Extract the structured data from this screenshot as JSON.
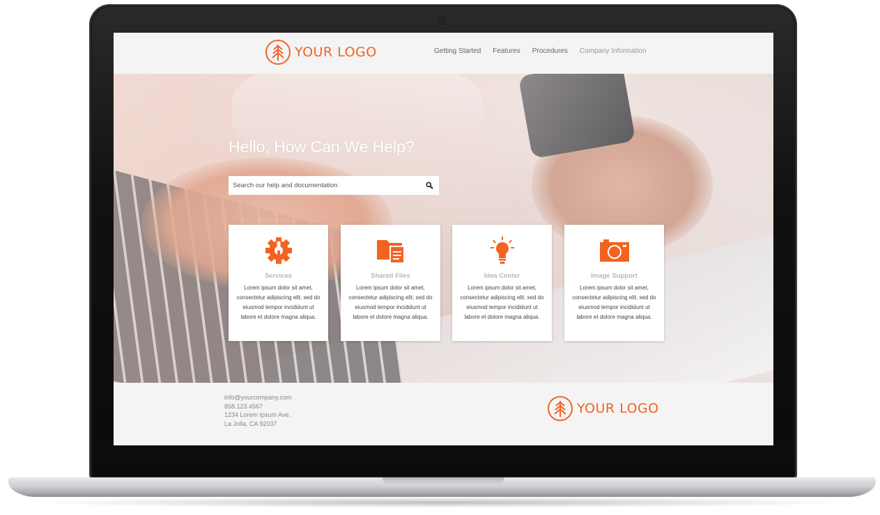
{
  "header": {
    "logo_text": "YOUR LOGO",
    "nav": [
      {
        "label": "Getting Started"
      },
      {
        "label": "Features"
      },
      {
        "label": "Procedures"
      },
      {
        "label": "Company Information"
      }
    ]
  },
  "hero": {
    "title": "Hello, How Can We Help?",
    "search_placeholder": "Search our help and documentation"
  },
  "cards": [
    {
      "icon": "gear-icon",
      "title": "Services",
      "body": "Lorem ipsum dolor sit amet, consectetur adipiscing elit, sed do eiusmod tempor incididunt ut labore et dolore magna aliqua."
    },
    {
      "icon": "folder-icon",
      "title": "Shared Files",
      "body": "Lorem ipsum dolor sit amet, consectetur adipiscing elit, sed do eiusmod tempor incididunt ut labore et dolore magna aliqua."
    },
    {
      "icon": "lightbulb-icon",
      "title": "Idea Center",
      "body": "Lorem ipsum dolor sit amet, consectetur adipiscing elit, sed do eiusmod tempor incididunt ut labore et dolore magna aliqua."
    },
    {
      "icon": "camera-icon",
      "title": "Image Support",
      "body": "Lorem ipsum dolor sit amet, consectetur adipiscing elit, sed do eiusmod tempor incididunt ut labore et dolore magna aliqua."
    }
  ],
  "footer": {
    "email": "info@yourcompany.com",
    "phone": "858.123.4567",
    "address_line1": "1234 Lorem Ipsum Ave.",
    "address_line2": "La Jolla, CA 92037",
    "logo_text": "YOUR LOGO"
  },
  "colors": {
    "accent": "#f26322"
  }
}
